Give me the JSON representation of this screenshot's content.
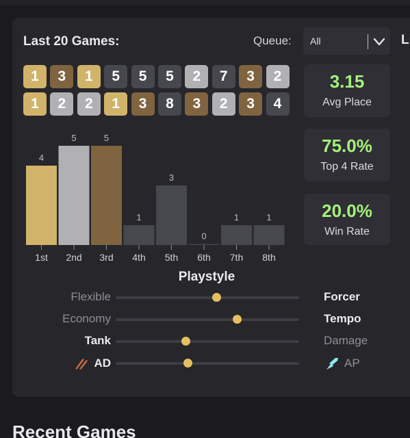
{
  "header": {
    "title": "Last 20 Games:",
    "queue_label": "Queue:",
    "queue_value": "All",
    "cutoff_text": "Li"
  },
  "colors": {
    "gold": "#d1b46a",
    "silver": "#b1b1b4",
    "bronze": "#80643f",
    "gray": "#47484d",
    "stat_green": "#a6f07a",
    "slider_knob": "#e3bf60"
  },
  "placements": [
    [
      "1",
      "3",
      "1",
      "5",
      "5",
      "5",
      "2",
      "7",
      "3",
      "2"
    ],
    [
      "1",
      "2",
      "2",
      "1",
      "3",
      "8",
      "3",
      "2",
      "3",
      "4"
    ]
  ],
  "stats": [
    {
      "value": "3.15",
      "label": "Avg Place"
    },
    {
      "value": "75.0%",
      "label": "Top 4 Rate"
    },
    {
      "value": "20.0%",
      "label": "Win Rate"
    }
  ],
  "chart_data": {
    "type": "bar",
    "categories": [
      "1st",
      "2nd",
      "3rd",
      "4th",
      "5th",
      "6th",
      "7th",
      "8th"
    ],
    "values": [
      4,
      5,
      5,
      1,
      3,
      0,
      1,
      1
    ],
    "ylim": [
      0,
      5
    ],
    "title": "",
    "xlabel": "",
    "ylabel": "",
    "bar_colors": [
      "#d1b46a",
      "#b1b1b4",
      "#80643f",
      "#47484d",
      "#47484d",
      "#47484d",
      "#47484d",
      "#47484d"
    ]
  },
  "playstyle": {
    "title": "Playstyle",
    "rows": [
      {
        "left": "Flexible",
        "right": "Forcer",
        "strong": "right",
        "value": 0.55,
        "icon_left": "",
        "icon_right": ""
      },
      {
        "left": "Economy",
        "right": "Tempo",
        "strong": "right",
        "value": 0.66,
        "icon_left": "",
        "icon_right": ""
      },
      {
        "left": "Tank",
        "right": "Damage",
        "strong": "left",
        "value": 0.38,
        "icon_left": "",
        "icon_right": ""
      },
      {
        "left": "AD",
        "right": "AP",
        "strong": "left",
        "value": 0.39,
        "icon_left": "sword-icon",
        "icon_right": "magic-icon"
      }
    ]
  },
  "footer": {
    "recent_title": "Recent Games"
  }
}
